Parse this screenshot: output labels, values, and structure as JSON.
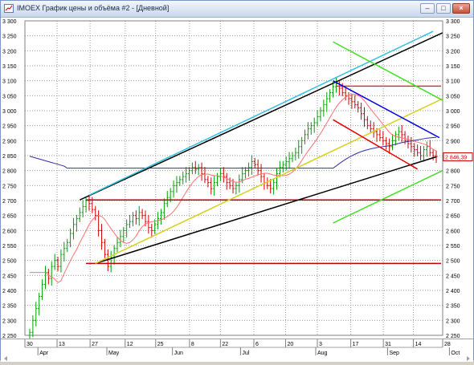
{
  "window": {
    "title": "IMOEX График цены и объёма #2 - [Дневной]",
    "buttons": [
      "–",
      "□",
      "×"
    ]
  },
  "chart_data": {
    "type": "candlestick",
    "y_ticks": [
      "2 250",
      "2 300",
      "2 350",
      "2 400",
      "2 450",
      "2 500",
      "2 550",
      "2 600",
      "2 650",
      "2 700",
      "2 750",
      "2 800",
      "2 850",
      "2 900",
      "2 950",
      "3 000",
      "3 050",
      "3 100",
      "3 150",
      "3 200",
      "3 250",
      "3 300"
    ],
    "ylim": [
      2250,
      3300
    ],
    "last_price": "2 846,39",
    "day_ticks": [
      {
        "label": "30",
        "pos": 0
      },
      {
        "label": "13",
        "pos": 0.077
      },
      {
        "label": "27",
        "pos": 0.156
      },
      {
        "label": "12",
        "pos": 0.24
      },
      {
        "label": "25",
        "pos": 0.313
      },
      {
        "label": "8",
        "pos": 0.394
      },
      {
        "label": "22",
        "pos": 0.468
      },
      {
        "label": "6",
        "pos": 0.548
      },
      {
        "label": "20",
        "pos": 0.624
      },
      {
        "label": "3",
        "pos": 0.7
      },
      {
        "label": "17",
        "pos": 0.78
      },
      {
        "label": "31",
        "pos": 0.858
      },
      {
        "label": "14",
        "pos": 0.93
      },
      {
        "label": "28",
        "pos": 1.0
      }
    ],
    "month_ticks": [
      {
        "label": "Apr",
        "pos": 0.035
      },
      {
        "label": "May",
        "pos": 0.2
      },
      {
        "label": "Jun",
        "pos": 0.357
      },
      {
        "label": "Jul",
        "pos": 0.52
      },
      {
        "label": "Aug",
        "pos": 0.7
      },
      {
        "label": "Sep",
        "pos": 0.872
      },
      {
        "label": "Oct",
        "pos": 1.02
      }
    ],
    "horizontal_levels": [
      {
        "price": 3082,
        "color": "#e03030"
      },
      {
        "price": 2702,
        "color": "#c00000"
      },
      {
        "price": 2490,
        "color": "#c00000"
      }
    ],
    "closes": [
      2260,
      2300,
      2340,
      2380,
      2420,
      2460,
      2440,
      2480,
      2500,
      2480,
      2520,
      2540,
      2560,
      2590,
      2620,
      2640,
      2660,
      2680,
      2700,
      2690,
      2670,
      2650,
      2600,
      2560,
      2520,
      2480,
      2510,
      2540,
      2560,
      2580,
      2600,
      2620,
      2630,
      2650,
      2640,
      2660,
      2650,
      2630,
      2610,
      2600,
      2620,
      2640,
      2660,
      2690,
      2710,
      2730,
      2750,
      2760,
      2770,
      2780,
      2790,
      2800,
      2810,
      2805,
      2810,
      2790,
      2770,
      2760,
      2740,
      2760,
      2780,
      2790,
      2780,
      2760,
      2750,
      2740,
      2750,
      2770,
      2790,
      2800,
      2810,
      2830,
      2820,
      2800,
      2780,
      2760,
      2750,
      2740,
      2760,
      2790,
      2810,
      2820,
      2830,
      2840,
      2850,
      2860,
      2880,
      2900,
      2920,
      2940,
      2950,
      2960,
      2980,
      3000,
      3020,
      3040,
      3060,
      3080,
      3090,
      3075,
      3060,
      3050,
      3040,
      3030,
      3020,
      3010,
      2990,
      2970,
      2950,
      2940,
      2930,
      2920,
      2910,
      2900,
      2890,
      2880,
      2900,
      2920,
      2930,
      2920,
      2900,
      2890,
      2880,
      2870,
      2860,
      2850,
      2870,
      2880,
      2860,
      2850,
      2846
    ],
    "colors": {
      "bull": "#00a000",
      "bear": "#d00000",
      "ma_short": "#ff7070",
      "ma_long": "#3030a0",
      "channel": "#000000",
      "cyan": "#30c0e0",
      "blue": "#0000e0",
      "green": "#40e020",
      "yellow": "#d8d020",
      "red": "#e00000"
    }
  }
}
